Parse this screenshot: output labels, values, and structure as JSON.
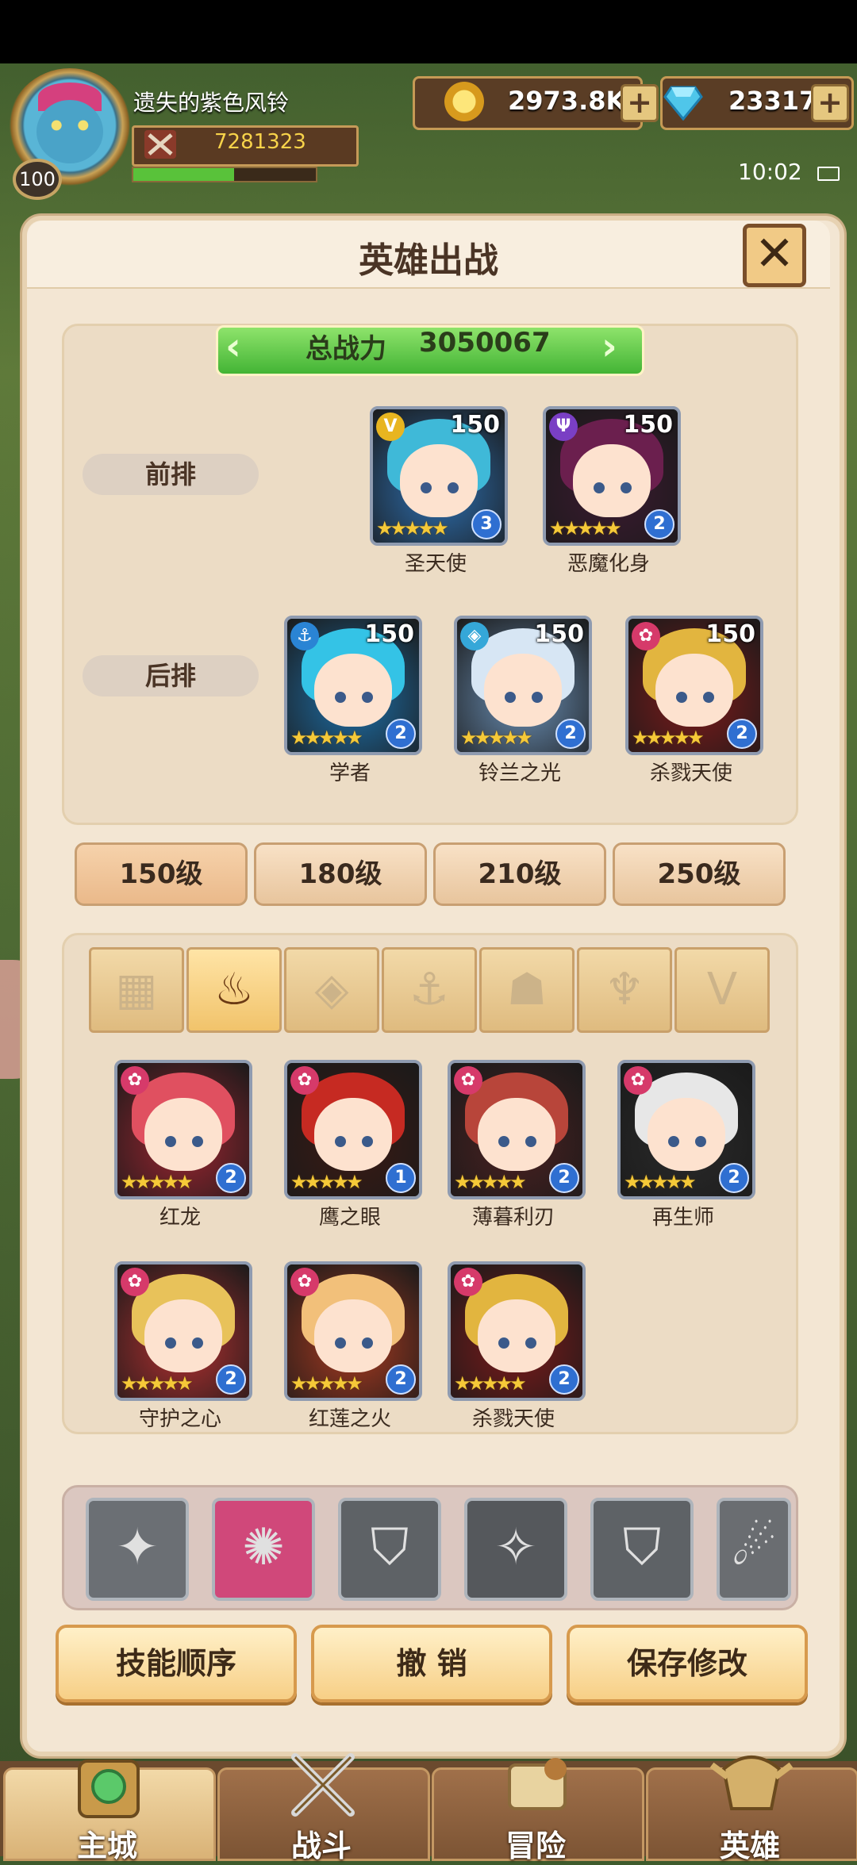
{
  "player": {
    "name": "遗失的紫色风铃",
    "level": "100",
    "power": "7281323",
    "xp_fraction": 0.55
  },
  "currency": {
    "gold": "2973.8K",
    "gems": "23317"
  },
  "status": {
    "time": "10:02"
  },
  "panel": {
    "title": "英雄出战",
    "close_label": "✕"
  },
  "formation": {
    "total_power_label": "总战力",
    "total_power_value": "3050067",
    "front_label": "前排",
    "back_label": "后排",
    "front": [
      {
        "name": "圣天使",
        "level": "150",
        "stars": "★★★★★",
        "rank": "3",
        "faction": "V",
        "faction_color": "#e8b520",
        "hair": "#3fb9d8",
        "bg": "#2d6fb0"
      },
      {
        "name": "恶魔化身",
        "level": "150",
        "stars": "★★★★★",
        "rank": "2",
        "faction": "Ψ",
        "faction_color": "#7a3fc4",
        "hair": "#6b1f4e",
        "bg": "#3b1a30"
      }
    ],
    "back": [
      {
        "name": "学者",
        "level": "150",
        "stars": "★★★★★",
        "rank": "2",
        "faction": "⚓",
        "faction_color": "#2a84d4",
        "hair": "#34c3e6",
        "bg": "#1e6fa8"
      },
      {
        "name": "铃兰之光",
        "level": "150",
        "stars": "★★★★★",
        "rank": "2",
        "faction": "◈",
        "faction_color": "#35a7d8",
        "hair": "#d7e6f4",
        "bg": "#6a8fb5"
      },
      {
        "name": "杀戮天使",
        "level": "150",
        "stars": "★★★★★",
        "rank": "2",
        "faction": "✿",
        "faction_color": "#d63a6a",
        "hair": "#e2b53f",
        "bg": "#7c1a1a"
      }
    ]
  },
  "level_tabs": [
    "150级",
    "180级",
    "210级",
    "250级"
  ],
  "filters": [
    {
      "icon": "grid-icon",
      "glyph": "▦"
    },
    {
      "icon": "flame-icon",
      "glyph": "♨"
    },
    {
      "icon": "crystal-icon",
      "glyph": "◈"
    },
    {
      "icon": "anchor-icon",
      "glyph": "⚓"
    },
    {
      "icon": "beast-icon",
      "glyph": "☗"
    },
    {
      "icon": "demon-icon",
      "glyph": "♆"
    },
    {
      "icon": "wing-icon",
      "glyph": "V"
    }
  ],
  "roster": [
    {
      "name": "红龙",
      "stars": "★★★★★",
      "rank": "2",
      "hair": "#e05060",
      "bg": "#9a2530"
    },
    {
      "name": "鹰之眼",
      "stars": "★★★★★",
      "rank": "1",
      "hair": "#c62a22",
      "bg": "#3a1a14"
    },
    {
      "name": "薄暮利刃",
      "stars": "★★★★★",
      "rank": "2",
      "hair": "#b8453a",
      "bg": "#4a2020"
    },
    {
      "name": "再生师",
      "stars": "★★★★★",
      "rank": "2",
      "hair": "#e7e7e7",
      "bg": "#2a2a2a"
    },
    {
      "name": "守护之心",
      "stars": "★★★★★",
      "rank": "2",
      "hair": "#e8c25a",
      "bg": "#b23030"
    },
    {
      "name": "红莲之火",
      "stars": "★★★★★",
      "rank": "2",
      "hair": "#f2c07a",
      "bg": "#a83a20"
    },
    {
      "name": "杀戮天使",
      "stars": "★★★★★",
      "rank": "2",
      "hair": "#e2b53f",
      "bg": "#7c1a1a"
    }
  ],
  "skills": [
    {
      "icon": "wing-skill-icon",
      "glyph": "✦",
      "color": "#6b6f74"
    },
    {
      "icon": "burst-skill-icon",
      "glyph": "✺",
      "color": "#d0487a"
    },
    {
      "icon": "shield-skill-icon",
      "glyph": "⛉",
      "color": "#5e6266"
    },
    {
      "icon": "strike-skill-icon",
      "glyph": "✧",
      "color": "#55585c"
    },
    {
      "icon": "shield-skill-icon",
      "glyph": "⛉",
      "color": "#5e6266"
    },
    {
      "icon": "claw-skill-icon",
      "glyph": "☄",
      "color": "#6a6d71"
    }
  ],
  "actions": {
    "skill_order": "技能顺序",
    "undo": "撤 销",
    "save": "保存修改"
  },
  "nav": {
    "main_city": "主城",
    "battle": "战斗",
    "adventure": "冒险",
    "heroes": "英雄"
  }
}
